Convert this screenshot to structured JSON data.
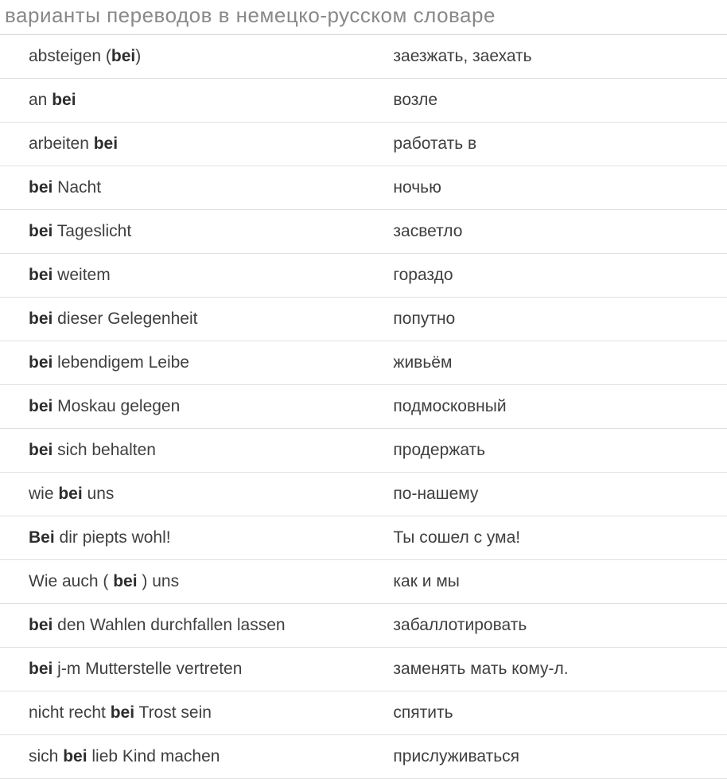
{
  "title": "варианты переводов в немецко-русском словаре",
  "rows": [
    {
      "german_pre": "absteigen (",
      "german_bold": "bei",
      "german_post": ")",
      "russian": "заезжать, заехать"
    },
    {
      "german_pre": "an ",
      "german_bold": "bei",
      "german_post": "",
      "russian": "возле"
    },
    {
      "german_pre": "arbeiten ",
      "german_bold": "bei",
      "german_post": "",
      "russian": "работать в"
    },
    {
      "german_pre": "",
      "german_bold": "bei",
      "german_post": " Nacht",
      "russian": "ночью"
    },
    {
      "german_pre": "",
      "german_bold": "bei",
      "german_post": " Tageslicht",
      "russian": "засветло"
    },
    {
      "german_pre": "",
      "german_bold": "bei",
      "german_post": " weitem",
      "russian": "гораздо"
    },
    {
      "german_pre": "",
      "german_bold": "bei",
      "german_post": " dieser Gelegenheit",
      "russian": "попутно"
    },
    {
      "german_pre": "",
      "german_bold": "bei",
      "german_post": " lebendigem Leibe",
      "russian": "живьём"
    },
    {
      "german_pre": "",
      "german_bold": "bei",
      "german_post": " Moskau gelegen",
      "russian": "подмосковный"
    },
    {
      "german_pre": "",
      "german_bold": "bei",
      "german_post": " sich behalten",
      "russian": "продержать"
    },
    {
      "german_pre": "wie ",
      "german_bold": "bei",
      "german_post": " uns",
      "russian": "по-нашему"
    },
    {
      "german_pre": "",
      "german_bold": "Bei",
      "german_post": " dir piepts wohl!",
      "russian": "Ты сошел с ума!"
    },
    {
      "german_pre": "Wie auch ( ",
      "german_bold": "bei",
      "german_post": " ) uns",
      "russian": "как и мы"
    },
    {
      "german_pre": "",
      "german_bold": "bei",
      "german_post": " den Wahlen durchfallen lassen",
      "russian": "забаллотировать"
    },
    {
      "german_pre": "",
      "german_bold": "bei",
      "german_post": " j-m Mutterstelle vertreten",
      "russian": "заменять мать кому-л."
    },
    {
      "german_pre": "nicht recht ",
      "german_bold": "bei",
      "german_post": " Trost sein",
      "russian": "спятить"
    },
    {
      "german_pre": "sich ",
      "german_bold": "bei",
      "german_post": " lieb Kind machen",
      "russian": "прислуживаться"
    }
  ]
}
